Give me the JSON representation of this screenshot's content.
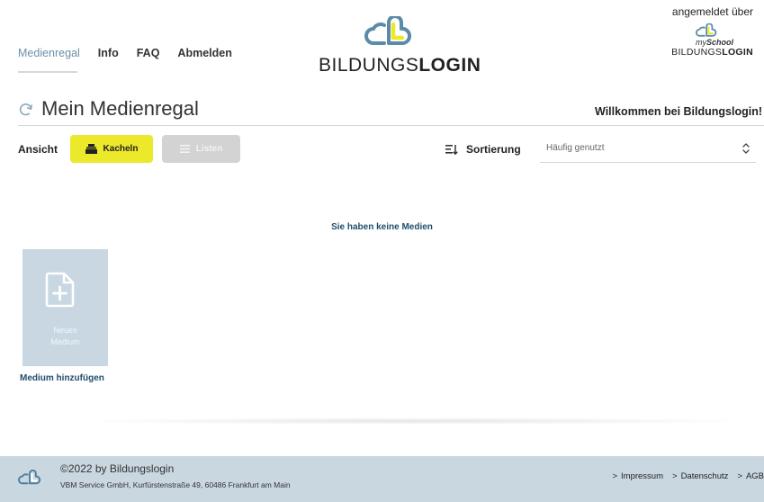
{
  "nav": {
    "items": [
      {
        "label": "Medienregal"
      },
      {
        "label": "Info"
      },
      {
        "label": "FAQ"
      },
      {
        "label": "Abmelden"
      }
    ]
  },
  "logo": {
    "text_regular": "BILDUNGS",
    "text_bold": "LOGIN"
  },
  "login_info": {
    "title": "angemeldet über",
    "my": "my",
    "school": "School",
    "brand_regular": "BILDUNGS",
    "brand_bold": "LOGIN"
  },
  "page": {
    "title": "Mein Medienregal",
    "welcome": "Willkommen bei Bildungslogin!"
  },
  "toolbar": {
    "view_label": "Ansicht",
    "kacheln_label": "Kacheln",
    "listen_label": "Listen",
    "sort_label": "Sortierung",
    "sort_value": "Häufig genutzt"
  },
  "content": {
    "empty_message": "Sie haben keine Medien",
    "tile_line1": "Neues",
    "tile_line2": "Medium",
    "tile_caption": "Medium hinzufügen"
  },
  "footer": {
    "copyright": "©2022 by Bildungslogin",
    "address": "VBM Service GmbH, Kurfürstenstraße 49, 60486 Frankfurt am Main",
    "links": [
      {
        "label": "Impressum"
      },
      {
        "label": "Datenschutz"
      },
      {
        "label": "AGB"
      }
    ]
  },
  "colors": {
    "accent_yellow": "#ece82a",
    "brand_blue": "#1f4e6b",
    "tile_bg": "#c8d7e1",
    "footer_bg": "#c9d7e1"
  }
}
